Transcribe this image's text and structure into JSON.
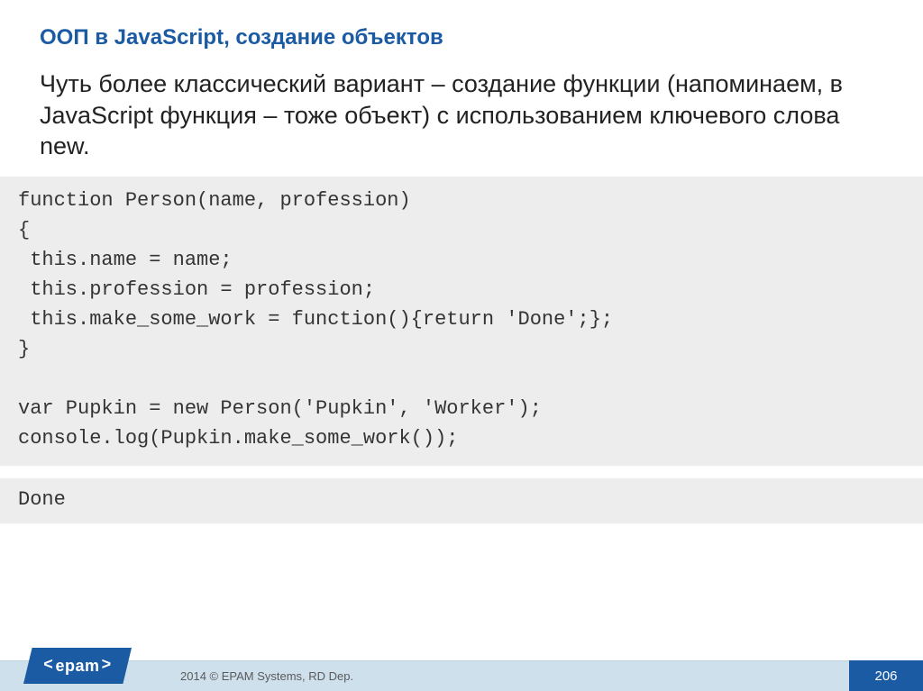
{
  "slide": {
    "title": "ООП в JavaScript, создание объектов",
    "paragraph": "Чуть более классический вариант – создание функции (напоминаем, в JavaScript функция – тоже объект) с использованием ключевого слова new.",
    "code": "function Person(name, profession)\n{\n this.name = name;\n this.profession = profession;\n this.make_some_work = function(){return 'Done';};\n}\n\nvar Pupkin = new Person('Pupkin', 'Worker');\nconsole.log(Pupkin.make_some_work());",
    "output": "Done"
  },
  "footer": {
    "copyright": "2014 © EPAM Systems, RD Dep.",
    "page_number": "206",
    "logo_text": "epam"
  }
}
